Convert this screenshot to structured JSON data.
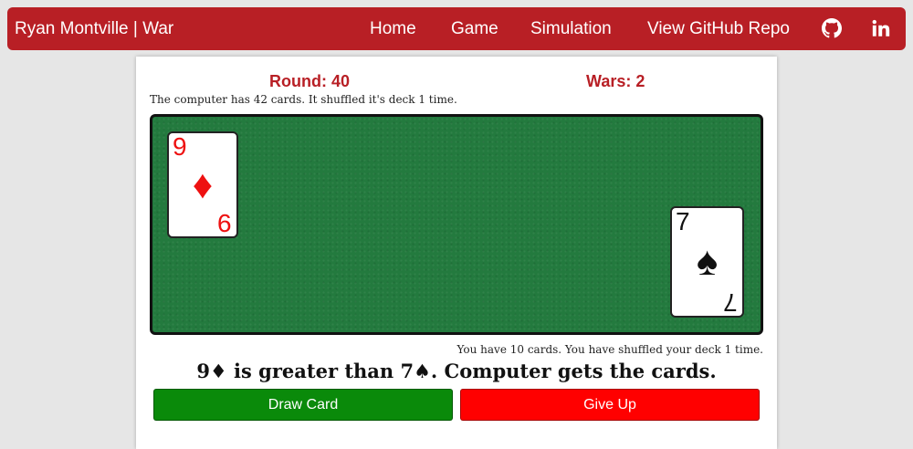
{
  "nav": {
    "brand": "Ryan Montville | War",
    "links": [
      "Home",
      "Game",
      "Simulation",
      "View GitHub Repo"
    ],
    "icons": [
      "github-icon",
      "linkedin-icon"
    ]
  },
  "game": {
    "round_label": "Round: 40",
    "wars_label": "Wars: 2",
    "computer_info": "The computer has 42 cards. It shuffled it's deck 1 time.",
    "player_info": "You have 10 cards. You have shuffled your deck 1 time.",
    "computer_card": {
      "rank": "9",
      "suit": "♦",
      "color": "#ee1111"
    },
    "player_card": {
      "rank": "7",
      "suit": "♠",
      "color": "#111111"
    },
    "result": "9♦ is greater than 7♠. Computer gets the cards."
  },
  "buttons": {
    "draw": "Draw Card",
    "give_up": "Give Up"
  },
  "colors": {
    "brand_red": "#b81f25",
    "felt_green": "#237a3e",
    "draw_green": "#0a8a0a",
    "give_up_red": "#ff0000"
  }
}
